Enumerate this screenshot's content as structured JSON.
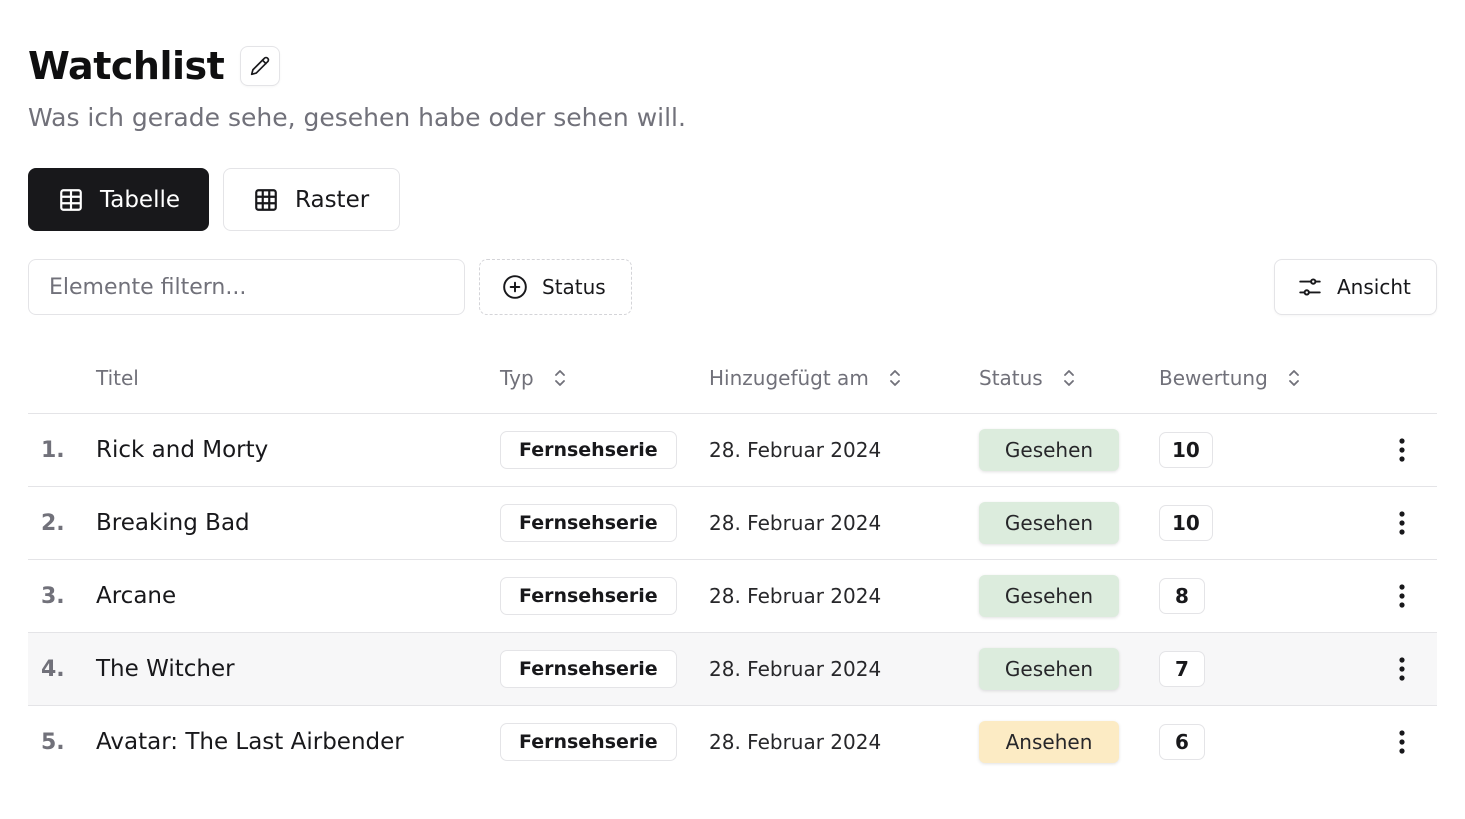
{
  "header": {
    "title": "Watchlist",
    "subtitle": "Was ich gerade sehe, gesehen habe oder sehen will."
  },
  "view_tabs": [
    {
      "label": "Tabelle",
      "icon": "table-icon",
      "active": true
    },
    {
      "label": "Raster",
      "icon": "grid-icon",
      "active": false
    }
  ],
  "toolbar": {
    "filter_placeholder": "Elemente filtern...",
    "status_filter_label": "Status",
    "view_label": "Ansicht"
  },
  "table": {
    "columns": [
      "Titel",
      "Typ",
      "Hinzugefügt am",
      "Status",
      "Bewertung"
    ],
    "rows": [
      {
        "num": "1.",
        "title": "Rick and Morty",
        "type": "Fernsehserie",
        "date": "28. Februar 2024",
        "status": "Gesehen",
        "rating": "10"
      },
      {
        "num": "2.",
        "title": "Breaking Bad",
        "type": "Fernsehserie",
        "date": "28. Februar 2024",
        "status": "Gesehen",
        "rating": "10"
      },
      {
        "num": "3.",
        "title": "Arcane",
        "type": "Fernsehserie",
        "date": "28. Februar 2024",
        "status": "Gesehen",
        "rating": "8"
      },
      {
        "num": "4.",
        "title": "The Witcher",
        "type": "Fernsehserie",
        "date": "28. Februar 2024",
        "status": "Gesehen",
        "rating": "7"
      },
      {
        "num": "5.",
        "title": "Avatar: The Last Airbender",
        "type": "Fernsehserie",
        "date": "28. Februar 2024",
        "status": "Ansehen",
        "rating": "6"
      }
    ]
  },
  "colors": {
    "primary": "#18181b",
    "muted_text": "#71717a",
    "border": "#e4e4e7",
    "status_gesehen": "#dcecdd",
    "status_ansehen": "#fcebc4",
    "row_highlight": "#f7f7f8"
  }
}
